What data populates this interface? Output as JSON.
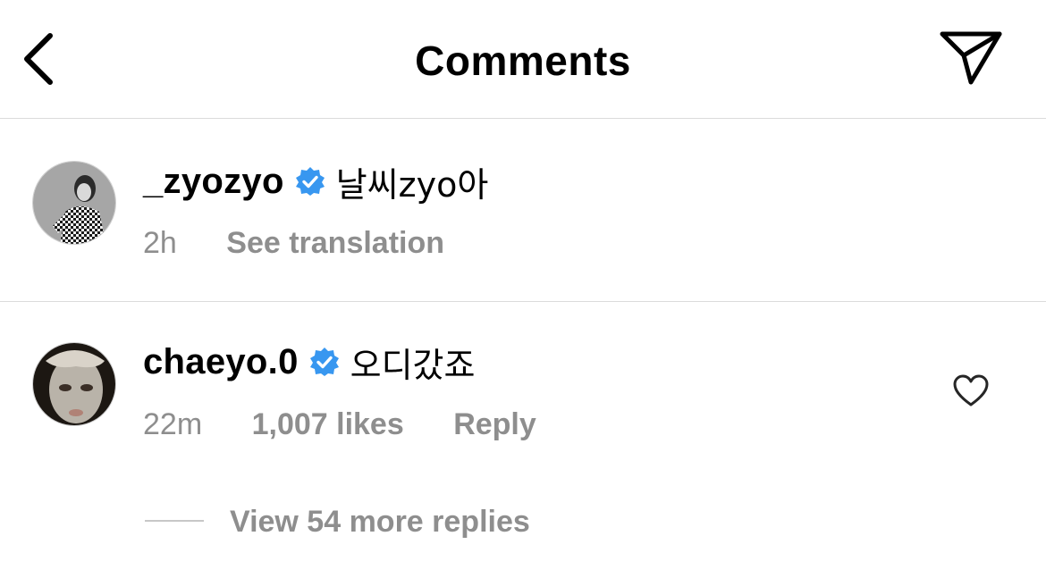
{
  "header": {
    "title": "Comments",
    "back_icon": "chevron-left-icon",
    "share_icon": "paper-plane-icon"
  },
  "comments": [
    {
      "username": "_zyozyo",
      "verified": true,
      "text": "날씨zyo아",
      "time": "2h",
      "translate_label": "See translation"
    },
    {
      "username": "chaeyo.0",
      "verified": true,
      "text": "오디갔죠",
      "time": "22m",
      "likes": "1,007 likes",
      "reply_label": "Reply",
      "view_replies_label": "View 54 more replies"
    }
  ],
  "colors": {
    "verified_blue": "#3897f0",
    "meta_gray": "#8e8e8e",
    "divider": "#dbdbdb"
  }
}
